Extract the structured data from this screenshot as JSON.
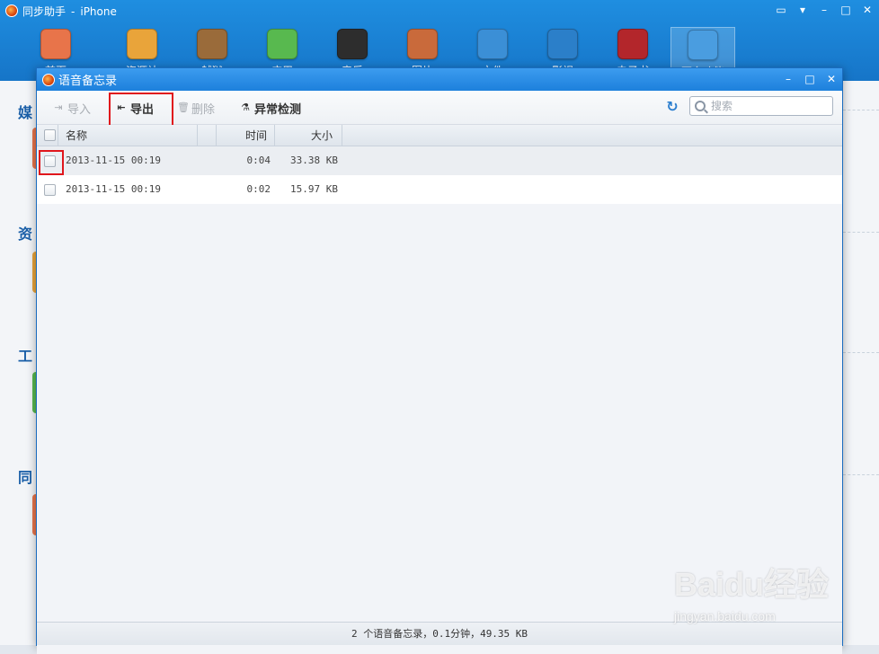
{
  "app": {
    "title": "同步助手",
    "device": "iPhone",
    "toolbar": [
      {
        "label": "首页",
        "icon": "home-icon",
        "color": "#e8744a"
      },
      {
        "label": "资源站",
        "icon": "shopping-bag-icon",
        "color": "#e9a43a"
      },
      {
        "label": "越狱",
        "icon": "pineapple-icon",
        "color": "#9a6b3a"
      },
      {
        "label": "应用",
        "icon": "apps-icon",
        "color": "#58b94f"
      },
      {
        "label": "音乐",
        "icon": "music-note-icon",
        "color": "#2d2d2d"
      },
      {
        "label": "图片",
        "icon": "photo-icon",
        "color": "#c96a3b"
      },
      {
        "label": "文件",
        "icon": "file-sync-icon",
        "color": "#3b8fd6"
      },
      {
        "label": "影视",
        "icon": "video-play-icon",
        "color": "#2b7fc9"
      },
      {
        "label": "电子书",
        "icon": "ebook-icon",
        "color": "#b3262b"
      },
      {
        "label": "更多功能",
        "icon": "tools-icon",
        "color": "#4a9de0"
      }
    ],
    "background_sections": [
      "媒",
      "资",
      "工",
      "同"
    ]
  },
  "dialog": {
    "title": "语音备忘录",
    "toolbar": {
      "import_label": "导入",
      "export_label": "导出",
      "delete_label": "删除",
      "check_label": "异常检测",
      "search_placeholder": "搜索"
    },
    "table": {
      "columns": {
        "name": "名称",
        "time": "时间",
        "size": "大小"
      },
      "rows": [
        {
          "name": "2013-11-15 00:19",
          "time": "0:04",
          "size": "33.38 KB"
        },
        {
          "name": "2013-11-15 00:19",
          "time": "0:02",
          "size": "15.97 KB"
        }
      ]
    },
    "status": "2 个语音备忘录，0.1分钟，49.35 KB"
  },
  "watermark": {
    "brand": "Baidu经验",
    "url": "jingyan.baidu.com"
  },
  "colors": {
    "accent": "#1d80dc",
    "highlight": "#e0161c"
  }
}
